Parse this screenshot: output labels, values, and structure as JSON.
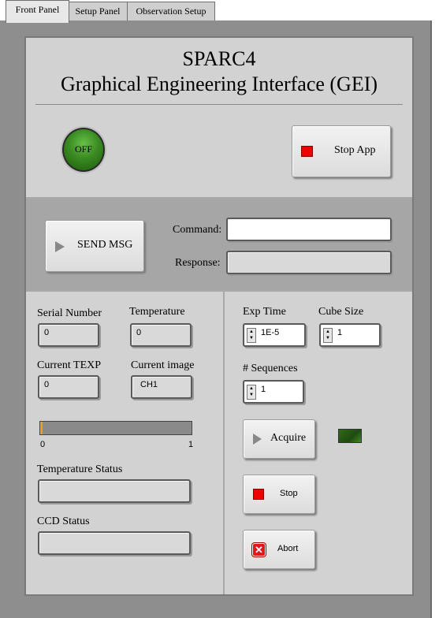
{
  "tabs": [
    {
      "label": "Front Panel",
      "active": true
    },
    {
      "label": "Setup Panel",
      "active": false
    },
    {
      "label": "Observation Setup",
      "active": false
    }
  ],
  "header": {
    "title": "SPARC4",
    "subtitle": "Graphical Engineering Interface (GEI)"
  },
  "power": {
    "led_label": "OFF",
    "stop_app_label": "Stop App"
  },
  "messaging": {
    "send_label": "SEND MSG",
    "command_label": "Command:",
    "command_value": "",
    "response_label": "Response:",
    "response_value": ""
  },
  "camera_info": {
    "serial_label": "Serial Number",
    "serial_value": "0",
    "temperature_label": "Temperature",
    "temperature_value": "0",
    "texp_label": "Current TEXP",
    "texp_value": "0",
    "image_label": "Current image",
    "image_value": "CH1",
    "progress": {
      "value": 0,
      "min_label": "0",
      "max_label": "1"
    },
    "temp_status_label": "Temperature Status",
    "temp_status_value": "",
    "ccd_status_label": "CCD Status",
    "ccd_status_value": ""
  },
  "acquisition": {
    "exp_time_label": "Exp Time",
    "exp_time_value": "1E-5",
    "cube_size_label": "Cube Size",
    "cube_size_value": "1",
    "sequences_label": "# Sequences",
    "sequences_value": "1",
    "acquire_label": "Acquire",
    "stop_label": "Stop",
    "abort_label": "Abort"
  },
  "colors": {
    "led_green": "#2f7d1a",
    "stop_red": "#ee0000",
    "progress_fill": "#e7a21a"
  }
}
